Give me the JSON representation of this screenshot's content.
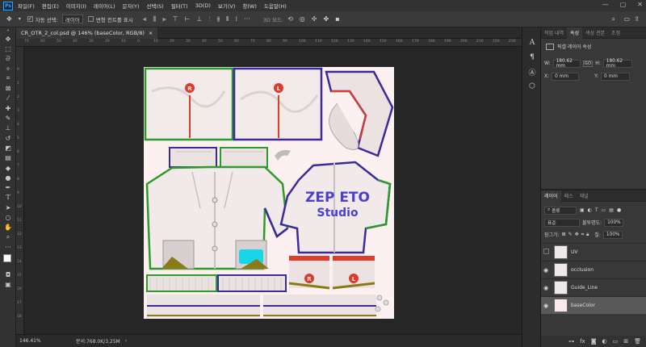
{
  "app": {
    "logo": "Ps",
    "window_controls": [
      "—",
      "▢",
      "✕"
    ]
  },
  "menu": [
    "파일(F)",
    "편집(E)",
    "이미지(I)",
    "레이어(L)",
    "문자(Y)",
    "선택(S)",
    "필터(T)",
    "3D(D)",
    "보기(V)",
    "창(W)",
    "도움말(H)"
  ],
  "options": {
    "auto_select_label": "자동 선택:",
    "auto_select_value": "레이어",
    "transform_controls_label": "변형 컨트롤 표시",
    "mode_3d_label": "3D 모드:"
  },
  "document_tab": {
    "title": "CR_OTR_2_col.psd @ 146% (baseColor, RGB/8)",
    "close": "×"
  },
  "ruler": {
    "h_ticks": [
      "70",
      "60",
      "50",
      "40",
      "30",
      "20",
      "10",
      "0",
      "10",
      "20",
      "30",
      "40",
      "50",
      "60",
      "70",
      "80",
      "90",
      "100",
      "110",
      "120",
      "130",
      "140",
      "150",
      "160",
      "170",
      "180",
      "190",
      "200",
      "210",
      "220",
      "230",
      "240",
      "250"
    ],
    "v_ticks": [
      "0",
      "1",
      "2",
      "3",
      "4",
      "5",
      "6",
      "7",
      "8",
      "9",
      "10",
      "11",
      "12",
      "13",
      "14",
      "15",
      "16",
      "17",
      "18"
    ]
  },
  "status": {
    "zoom": "146.41%",
    "doc_size": "문서:768.0K/3.25M",
    "arrow": "›"
  },
  "canvas_text": {
    "logo_line1": "ZEP ETO",
    "logo_line2": "Studio",
    "badge_r": "R",
    "badge_l": "L"
  },
  "properties_panel": {
    "tabs": [
      "작업 내역",
      "속성",
      "색상 견본",
      "조정"
    ],
    "active_tab": 1,
    "header": "픽셀 레이어 속성",
    "w_label": "W:",
    "w_value": "180.62 mm",
    "link_icon": "GO",
    "h_label": "H:",
    "h_value": "180.62 mm",
    "x_label": "X:",
    "x_value": "0 mm",
    "y_label": "Y:",
    "y_value": "0 mm"
  },
  "layers_panel": {
    "tabs": [
      "레이어",
      "패스",
      "채널"
    ],
    "active_tab": 0,
    "filter_label": "종류",
    "blend_mode": "표준",
    "opacity_label": "불투명도:",
    "opacity_value": "100%",
    "lock_label": "잠그기:",
    "fill_label": "칠:",
    "fill_value": "100%",
    "layers": [
      {
        "name": "UV",
        "visible": false,
        "selected": false
      },
      {
        "name": "occlusion",
        "visible": true,
        "selected": false
      },
      {
        "name": "Guide_Line",
        "visible": true,
        "selected": false
      },
      {
        "name": "baseColor",
        "visible": true,
        "selected": true
      }
    ]
  },
  "colors": {
    "red_seam": "#e03a2a",
    "blue_seam": "#3a2a9a",
    "green_seam": "#2e9a2a",
    "brand_purple": "#4b3fd0",
    "olive": "#8a7a18",
    "cyan": "#19d6e6"
  }
}
